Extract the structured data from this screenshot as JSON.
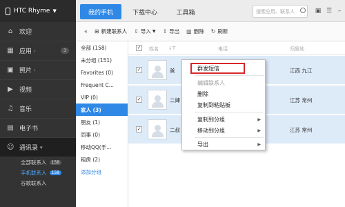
{
  "device": {
    "name": "HTC Rhyme"
  },
  "top_tabs": [
    {
      "label": "我的手机"
    },
    {
      "label": "下载中心"
    },
    {
      "label": "工具箱"
    }
  ],
  "search": {
    "placeholder": "搜索应用、联系人"
  },
  "nav": {
    "items": [
      {
        "label": "欢迎",
        "icon": "home-icon"
      },
      {
        "label": "应用",
        "icon": "apps-icon",
        "badge": "3"
      },
      {
        "label": "照片",
        "icon": "photo-icon"
      },
      {
        "label": "视频",
        "icon": "video-icon"
      },
      {
        "label": "音乐",
        "icon": "music-icon"
      },
      {
        "label": "电子书",
        "icon": "book-icon"
      },
      {
        "label": "通讯录",
        "icon": "contacts-icon"
      }
    ],
    "subitems": [
      {
        "label": "全部联系人",
        "count": "158"
      },
      {
        "label": "手机联系人",
        "count": "158"
      },
      {
        "label": "谷歌联系人",
        "count": ""
      }
    ]
  },
  "toolbar": {
    "new_contact": "新建联系人",
    "import": "导入",
    "export": "导出",
    "delete": "删除",
    "refresh": "刷新"
  },
  "groups": [
    "全部 (158)",
    "未分组 (151)",
    "Favorites (0)",
    "Frequent C...",
    "VIP (0)",
    "家人 (3)",
    "朋友 (1)",
    "同事 (0)",
    "移动QQ(手...",
    "租房 (2)",
    "添加分组"
  ],
  "table": {
    "headers": {
      "name": "姓名",
      "sort": "↓T",
      "phone": "电话",
      "location": "归属地"
    },
    "rows": [
      {
        "name": "爸",
        "location": "江西 九江"
      },
      {
        "name": "二婶",
        "location": "江苏 常州"
      },
      {
        "name": "二叔",
        "location": "江苏 常州"
      }
    ]
  },
  "context_menu": {
    "send_sms": "群发短信",
    "edit": "编辑联系人",
    "delete": "删除",
    "copy_clipboard": "复制到粘贴板",
    "copy_group": "复制到分组",
    "move_group": "移动到分组",
    "export": "导出"
  },
  "colors": {
    "accent": "#2f88e6",
    "highlight_border": "#d8262d",
    "nav_bg": "#333333"
  }
}
